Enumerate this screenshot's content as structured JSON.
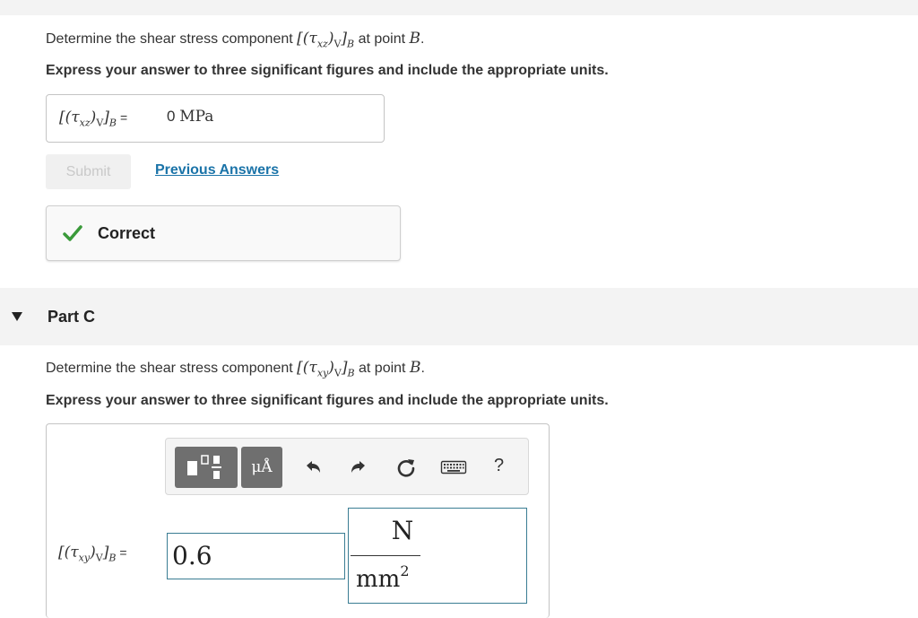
{
  "part_b": {
    "prompt_prefix": "Determine the shear stress component",
    "prompt_suffix": "at point",
    "point": "B",
    "period": ".",
    "instructions": "Express your answer to three significant figures and include the appropriate units.",
    "var_tau": "τ",
    "var_sub": "xz",
    "var_v": "V",
    "var_b": "B",
    "equals": "=",
    "answer_number": "0",
    "answer_unit": "MPa",
    "submit_label": "Submit",
    "previous_answers_label": "Previous Answers",
    "feedback_label": "Correct"
  },
  "part_c": {
    "title": "Part C",
    "prompt_prefix": "Determine the shear stress component",
    "prompt_suffix": "at point",
    "point": "B",
    "period": ".",
    "instructions": "Express your answer to three significant figures and include the appropriate units.",
    "var_tau": "τ",
    "var_sub": "xy",
    "var_v": "V",
    "var_b": "B",
    "equals": "=",
    "value": "0.6",
    "unit_numerator": "N",
    "unit_denominator": "mm",
    "unit_exponent": "2",
    "toolbar": {
      "units_label": "μÅ",
      "help_label": "?"
    }
  },
  "colors": {
    "link": "#1a73a8",
    "correct_check": "#3a9a3a",
    "input_border": "#3a7d93",
    "toolbar_button": "#6f6f6f"
  }
}
